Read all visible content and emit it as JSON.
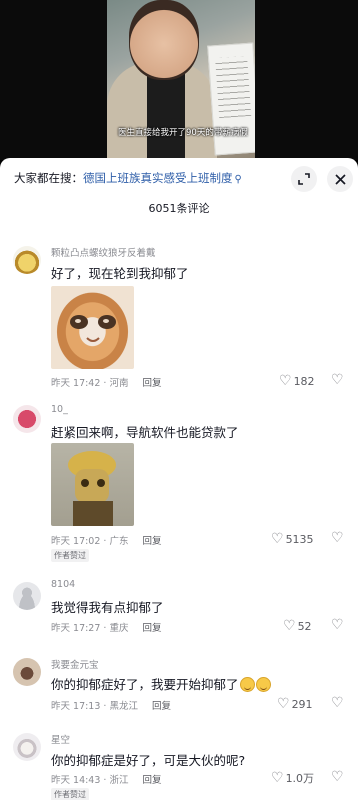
{
  "video": {
    "subtitle": "医生直接给我开了90天的带薪病假"
  },
  "header": {
    "search_prefix": "大家都在搜：",
    "search_link": "德国上班族真实感受上班制度",
    "search_icon": "search-icon",
    "expand_icon": "expand-icon",
    "close_icon": "close-icon",
    "count": "6051条评论"
  },
  "comments": [
    {
      "user": "颗粒凸点螺纹狼牙反着戴",
      "text": "好了，现在轮到我抑郁了",
      "time_loc": "昨天 17:42 · 河南",
      "reply": "回复",
      "likes": "182",
      "image": "crying-cat-meme"
    },
    {
      "user": "10_",
      "text": "赶紧回来啊，导航软件也能贷款了",
      "time_loc": "昨天 17:02 · 广东",
      "reply": "回复",
      "likes": "5135",
      "image": "figurine-meme",
      "author_tag": "作者赞过"
    },
    {
      "user": "8104",
      "text": "我觉得我有点抑郁了",
      "time_loc": "昨天 17:27 · 重庆",
      "reply": "回复",
      "likes": "52"
    },
    {
      "user": "我要金元宝",
      "text": "你的抑郁症好了，我要开始抑郁了",
      "time_loc": "昨天 17:13 · 黑龙江",
      "reply": "回复",
      "likes": "291"
    },
    {
      "user": "星空",
      "text": "你的抑郁症是好了，可是大伙的呢?",
      "time_loc": "昨天 14:43 · 浙江",
      "reply": "回复",
      "likes": "1.0万",
      "author_tag": "作者赞过"
    }
  ],
  "colors": {
    "link": "#2d5da8",
    "meta": "#8a8b91",
    "text": "#161823"
  }
}
